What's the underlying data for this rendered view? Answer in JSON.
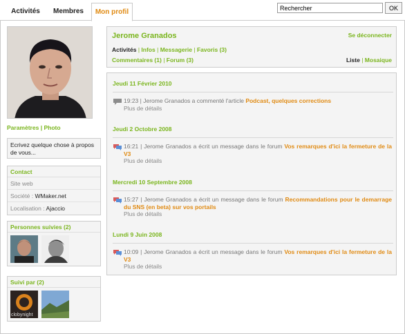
{
  "tabs": [
    {
      "label": "Activités"
    },
    {
      "label": "Membres"
    },
    {
      "label": "Mon profil"
    }
  ],
  "search": {
    "value": "Rechercher",
    "button": "OK"
  },
  "left": {
    "links": {
      "settings": "Paramètres",
      "sep": "|",
      "photo": "Photo"
    },
    "status_placeholder": "Ecrivez quelque chose à propos de vous...",
    "contact": {
      "title": "Contact",
      "website_label": "Site web",
      "company_label": "Société :",
      "company_value": "WMaker.net",
      "location_label": "Localisation :",
      "location_value": "Ajaccio"
    },
    "following": {
      "title": "Personnes suivies (2)"
    },
    "followers": {
      "title": "Suivi par (2)",
      "thumb1_caption": "clobynight"
    }
  },
  "profile": {
    "name": "Jerome Granados",
    "logout": "Se déconnecter",
    "nav1": [
      "Activités",
      "Infos",
      "Messagerie",
      "Favoris (3)"
    ],
    "nav2": [
      "Commentaires (1)",
      "Forum (3)"
    ],
    "view": {
      "list": "Liste",
      "mosaic": "Mosaique"
    }
  },
  "feed": [
    {
      "date": "Jeudi 11 Février 2010",
      "time": "19:23",
      "text": "Jerome Granados a commenté l'article",
      "link": "Podcast, quelques corrections",
      "more": "Plus de détails",
      "icon": "comment-icon"
    },
    {
      "date": "Jeudi 2 Octobre 2008",
      "time": "16:21",
      "text": "Jerome Granados a écrit un message dans le forum",
      "link": "Vos remarques d'ici la fermeture de la V3",
      "more": "Plus de détails",
      "icon": "forum-icon"
    },
    {
      "date": "Mercredi 10 Septembre 2008",
      "time": "15:27",
      "text": "Jerome Granados a écrit un message dans le forum",
      "link": "Recommandations pour le demarrage du SNS (en beta) sur vos portails",
      "more": "Plus de détails",
      "icon": "forum-icon"
    },
    {
      "date": "Lundi 9 Juin 2008",
      "time": "10:09",
      "text": "Jerome Granados a écrit un message dans le forum",
      "link": "Vos remarques d'ici la fermeture de la V3",
      "more": "Plus de détails",
      "icon": "forum-icon"
    }
  ],
  "colors": {
    "accent": "#7ab51d",
    "link": "#e08a12"
  }
}
